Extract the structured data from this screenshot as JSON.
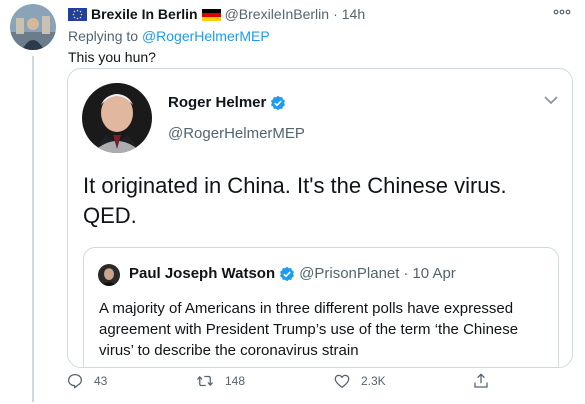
{
  "tweet": {
    "display_name": "Brexile In Berlin",
    "handle": "@BrexileInBerlin",
    "separator": "·",
    "time": "14h",
    "replying_prefix": "Replying to",
    "replying_to": "@RogerHelmerMEP",
    "text": "This you hun?"
  },
  "quoted": {
    "display_name": "Roger Helmer",
    "handle": "@RogerHelmerMEP",
    "text": "It originated in China.  It's the Chinese virus. QED.",
    "nested": {
      "display_name": "Paul Joseph Watson",
      "handle": "@PrisonPlanet",
      "separator": "·",
      "date": "10 Apr",
      "text": "A majority of Americans in three different polls have expressed agreement with President Trump’s use of the term ‘the Chinese virus’ to describe the coronavirus strain"
    }
  },
  "actions": {
    "reply_count": "43",
    "retweet_count": "148",
    "like_count": "2.3K"
  },
  "icons": [
    "eu-flag-icon",
    "germany-flag-icon",
    "more-icon",
    "verified-icon",
    "chevron-down-icon",
    "reply-icon",
    "retweet-icon",
    "like-icon",
    "share-icon"
  ],
  "colors": {
    "accent": "#1d9bf0",
    "secondary_text": "#536471",
    "border": "#cfd9de"
  }
}
